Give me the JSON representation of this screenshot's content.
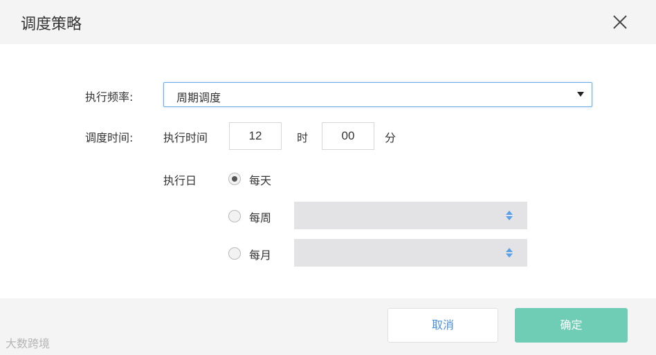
{
  "dialog": {
    "title": "调度策略",
    "close_icon": "close-icon"
  },
  "form": {
    "frequency": {
      "label": "执行频率:",
      "selected": "周期调度",
      "icon": "caret-down-icon"
    },
    "schedule_time": {
      "label": "调度时间:",
      "exec_time_label": "执行时间",
      "hour": "12",
      "hour_unit": "时",
      "minute": "00",
      "minute_unit": "分"
    },
    "exec_day": {
      "label": "执行日",
      "options": [
        {
          "label": "每天",
          "checked": true
        },
        {
          "label": "每周",
          "checked": false,
          "dropdown_value": ""
        },
        {
          "label": "每月",
          "checked": false,
          "dropdown_value": ""
        }
      ]
    }
  },
  "footer": {
    "cancel_label": "取消",
    "confirm_label": "确定"
  },
  "watermark": "大数跨境",
  "colors": {
    "accent_blue": "#4a8fdc",
    "confirm_green": "#6fcdb5",
    "header_bg": "#f4f4f4",
    "dropdown_bg": "#e3e3e5"
  }
}
